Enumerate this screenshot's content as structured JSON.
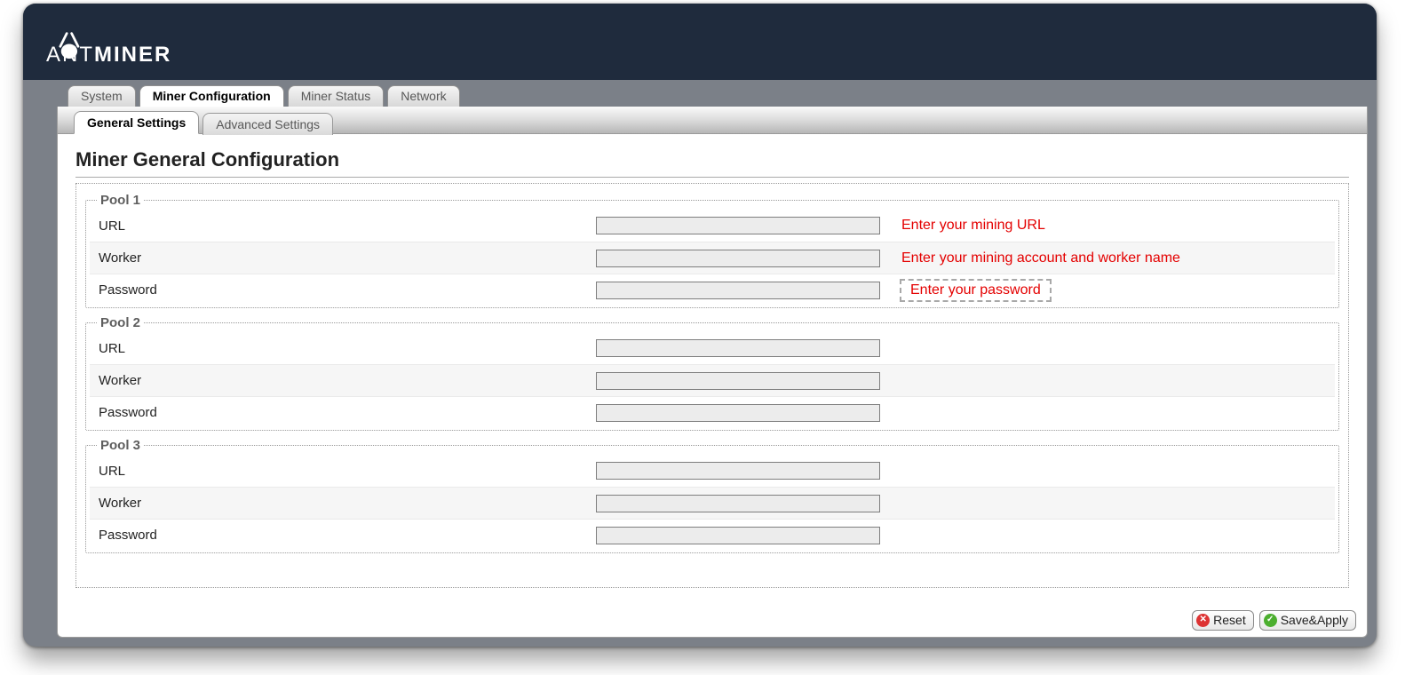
{
  "brand": {
    "thin": "ANT",
    "bold": "MINER"
  },
  "tabs_primary": [
    {
      "label": "System",
      "active": false
    },
    {
      "label": "Miner Configuration",
      "active": true
    },
    {
      "label": "Miner Status",
      "active": false
    },
    {
      "label": "Network",
      "active": false
    }
  ],
  "tabs_secondary": [
    {
      "label": "General Settings",
      "active": true
    },
    {
      "label": "Advanced Settings",
      "active": false
    }
  ],
  "page_title": "Miner General Configuration",
  "pools": [
    {
      "legend": "Pool 1",
      "rows": [
        {
          "label": "URL",
          "value": "",
          "hint": "Enter your mining URL",
          "hint_boxed": false
        },
        {
          "label": "Worker",
          "value": "",
          "hint": "Enter your mining account and worker name",
          "hint_boxed": false
        },
        {
          "label": "Password",
          "value": "",
          "hint": "Enter your password",
          "hint_boxed": true
        }
      ]
    },
    {
      "legend": "Pool 2",
      "rows": [
        {
          "label": "URL",
          "value": "",
          "hint": "",
          "hint_boxed": false
        },
        {
          "label": "Worker",
          "value": "",
          "hint": "",
          "hint_boxed": false
        },
        {
          "label": "Password",
          "value": "",
          "hint": "",
          "hint_boxed": false
        }
      ]
    },
    {
      "legend": "Pool 3",
      "rows": [
        {
          "label": "URL",
          "value": "",
          "hint": "",
          "hint_boxed": false
        },
        {
          "label": "Worker",
          "value": "",
          "hint": "",
          "hint_boxed": false
        },
        {
          "label": "Password",
          "value": "",
          "hint": "",
          "hint_boxed": false
        }
      ]
    }
  ],
  "footer": {
    "reset_label": "Reset",
    "save_label": "Save&Apply"
  }
}
